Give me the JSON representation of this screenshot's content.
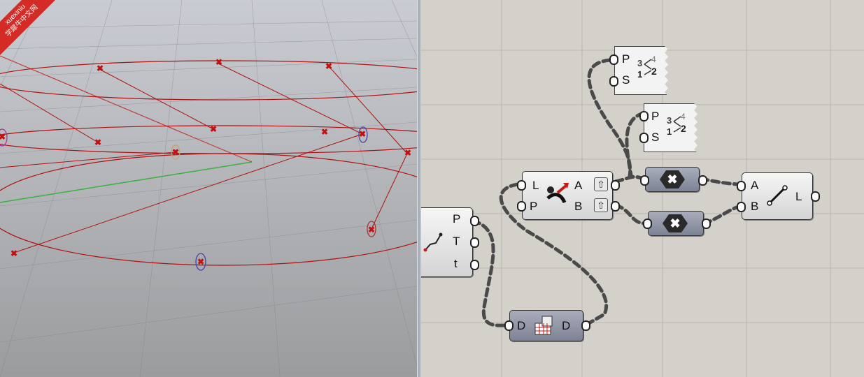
{
  "watermark": {
    "line1": "xuexiniu",
    "line2": "学犀牛中文网"
  },
  "components": {
    "panel1": {
      "p": "P",
      "s": "S"
    },
    "panel2": {
      "p": "P",
      "s": "S"
    },
    "evaluate": {
      "in_l": "L",
      "in_p": "P",
      "out_a": "A",
      "out_b": "B"
    },
    "curve_param": {
      "p": "P",
      "t": "T",
      "t2": "t"
    },
    "line": {
      "a": "A",
      "b": "B",
      "out": "L"
    },
    "data": {
      "in": "D",
      "out": "D"
    },
    "negate1": {
      "glyph": "✖"
    },
    "negate2": {
      "glyph": "✖"
    }
  },
  "icons": [
    "panel-icon",
    "evaluate-curve-icon",
    "param-icon",
    "line-icon",
    "data-tree-icon",
    "negative-icon"
  ],
  "colors": {
    "curve": "#b01010",
    "wire": "#555555",
    "canvas": "#d4d1ca"
  }
}
